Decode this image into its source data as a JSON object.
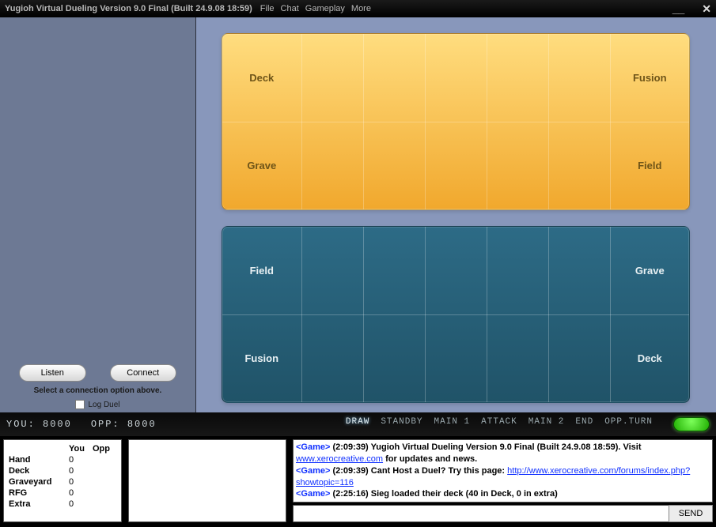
{
  "titlebar": {
    "title": "Yugioh Virtual Dueling Version 9.0 Final (Built 24.9.08 18:59)",
    "menu": [
      "File",
      "Chat",
      "Gameplay",
      "More"
    ]
  },
  "left": {
    "listen": "Listen",
    "connect": "Connect",
    "hint": "Select a connection option above.",
    "logduel": "Log Duel"
  },
  "board": {
    "opp": {
      "r1l": "Deck",
      "r1r": "Fusion",
      "r2l": "Grave",
      "r2r": "Field"
    },
    "you": {
      "r1l": "Field",
      "r1r": "Grave",
      "r2l": "Fusion",
      "r2r": "Deck"
    }
  },
  "status": {
    "you_label": "YOU:",
    "you_lp": "8000",
    "opp_label": "OPP:",
    "opp_lp": "8000",
    "phases": [
      "DRAW",
      "STANDBY",
      "MAIN 1",
      "ATTACK",
      "MAIN 2",
      "END",
      "OPP.TURN"
    ]
  },
  "stats": {
    "cols": [
      "",
      "You",
      "Opp"
    ],
    "rows": [
      {
        "label": "Hand",
        "you": "0",
        "opp": ""
      },
      {
        "label": "Deck",
        "you": "0",
        "opp": ""
      },
      {
        "label": "Graveyard",
        "you": "0",
        "opp": ""
      },
      {
        "label": "RFG",
        "you": "0",
        "opp": ""
      },
      {
        "label": "Extra",
        "you": "0",
        "opp": ""
      }
    ]
  },
  "chat": {
    "l1_pre": "<Game>",
    "l1_ts": " (2:09:39) Yugioh Virtual Dueling Version 9.0 Final (Built 24.9.08 18:59). Visit ",
    "l1_link": "www.xerocreative.com",
    "l1_post": " for updates and news.",
    "l2_pre": "<Game>",
    "l2_ts": " (2:09:39) Cant Host a Duel? Try this page: ",
    "l2_link": "http://www.xerocreative.com/forums/index.php?showtopic=116",
    "l3_pre": "<Game>",
    "l3_ts": " (2:25:16) Sieg loaded their deck (40 in Deck, 0 in extra)",
    "send": "SEND"
  }
}
